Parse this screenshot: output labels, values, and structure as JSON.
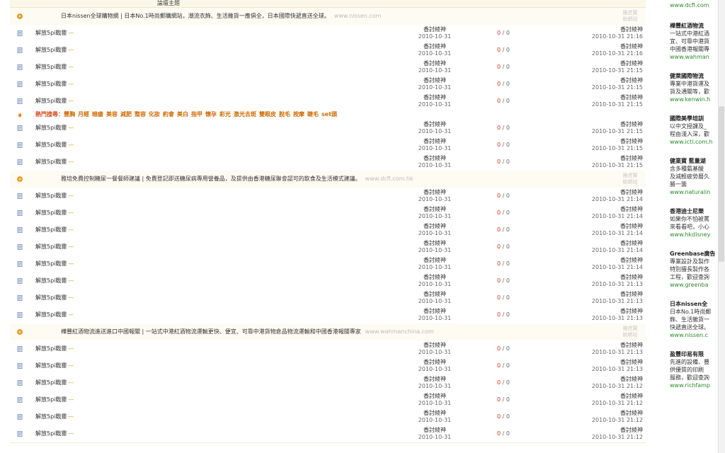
{
  "header": {
    "title": "論壇主題"
  },
  "colors": {
    "accent_red": "#e0301e",
    "hot_orange": "#d06a00",
    "sidebar_url_green": "#2b8a2b"
  },
  "topic_title": "解放5pi戰靈",
  "author_name": "香討綾神",
  "date": "2010-10-31",
  "ad_link_label": "雅虎贊\n助網站",
  "rows": [
    {
      "type": "ad",
      "text": "日本nissen全球購物網 | 日本No.1時尚郵購網站，潮流衣飾、生活雜貨一應俱全，日本國際快遞直送全球。",
      "url": "www.nissen.com"
    },
    {
      "type": "topic",
      "replies": "0",
      "views": "0",
      "last_name": "香討綾神",
      "last_time": "2010-10-31 21:16"
    },
    {
      "type": "topic",
      "replies": "0",
      "views": "0",
      "last_name": "香討綾神",
      "last_time": "2010-10-31 21:16"
    },
    {
      "type": "topic",
      "replies": "0",
      "views": "0",
      "last_name": "香討綾神",
      "last_time": "2010-10-31 21:15"
    },
    {
      "type": "topic",
      "replies": "0",
      "views": "0",
      "last_name": "香討綾神",
      "last_time": "2010-10-31 21:15"
    },
    {
      "type": "topic",
      "replies": "0",
      "views": "0",
      "last_name": "香討綾神",
      "last_time": "2010-10-31 21:15"
    },
    {
      "type": "hot"
    },
    {
      "type": "topic",
      "replies": "0",
      "views": "0",
      "last_name": "香討綾神",
      "last_time": "2010-10-31 21:15"
    },
    {
      "type": "topic",
      "replies": "0",
      "views": "0",
      "last_name": "香討綾神",
      "last_time": "2010-10-31 21:15"
    },
    {
      "type": "topic",
      "replies": "0",
      "views": "0",
      "last_name": "香討綾神",
      "last_time": "2010-10-31 21:15"
    },
    {
      "type": "ad",
      "text": "雅培免費控制糖尿一餐餐師建議 | 免費登記即送糖尿病專用營養品，及提供由香港糖尿聯會認可的飲食及生活模式建議。",
      "url": "www.dcfl.com.hk"
    },
    {
      "type": "topic",
      "replies": "0",
      "views": "0",
      "last_name": "香討綾神",
      "last_time": "2010-10-31 21:14"
    },
    {
      "type": "topic",
      "replies": "0",
      "views": "0",
      "last_name": "香討綾神",
      "last_time": "2010-10-31 21:14"
    },
    {
      "type": "topic",
      "replies": "0",
      "views": "0",
      "last_name": "香討綾神",
      "last_time": "2010-10-31 21:14"
    },
    {
      "type": "topic",
      "replies": "0",
      "views": "0",
      "last_name": "香討綾神",
      "last_time": "2010-10-31 21:14"
    },
    {
      "type": "topic",
      "replies": "0",
      "views": "0",
      "last_name": "香討綾神",
      "last_time": "2010-10-31 21:14"
    },
    {
      "type": "topic",
      "replies": "0",
      "views": "0",
      "last_name": "香討綾神",
      "last_time": "2010-10-31 21:13"
    },
    {
      "type": "topic",
      "replies": "0",
      "views": "0",
      "last_name": "香討綾神",
      "last_time": "2010-10-31 21:13"
    },
    {
      "type": "topic",
      "replies": "0",
      "views": "0",
      "last_name": "香討綾神",
      "last_time": "2010-10-31 21:13"
    },
    {
      "type": "ad",
      "text": "樺豐紅酒物流進送進口中國報關 | 一站式中港紅酒物流運輸更快、便宜、可靠中港貨物倉品物流運輸和中國香港報關專家",
      "url": "www.wahmanchina.com"
    },
    {
      "type": "topic",
      "replies": "0",
      "views": "0",
      "last_name": "香討綾神",
      "last_time": "2010-10-31 21:13"
    },
    {
      "type": "topic",
      "replies": "0",
      "views": "0",
      "last_name": "香討綾神",
      "last_time": "2010-10-31 21:13"
    },
    {
      "type": "topic",
      "replies": "0",
      "views": "0",
      "last_name": "香討綾神",
      "last_time": "2010-10-31 21:12"
    },
    {
      "type": "topic",
      "replies": "0",
      "views": "0",
      "last_name": "香討綾神",
      "last_time": "2010-10-31 21:12"
    },
    {
      "type": "topic",
      "replies": "0",
      "views": "0",
      "last_name": "香討綾神",
      "last_time": "2010-10-31 21:12"
    },
    {
      "type": "topic",
      "replies": "0",
      "views": "0",
      "last_name": "香討綾神",
      "last_time": "2010-10-31 21:12"
    }
  ],
  "hot_search": {
    "label": "熱門搜尋：",
    "keywords": [
      "豐胸",
      "月經",
      "暗瘡",
      "美容",
      "減肥",
      "整容",
      "化妝",
      "約會",
      "美白",
      "指甲",
      "懷孕",
      "彩光",
      "激光去斑",
      "雙眼皮",
      "脫毛",
      "按摩",
      "睫毛",
      "set頭"
    ]
  },
  "sidebar": [
    {
      "title": "",
      "desc": [],
      "url": "www.dcfl.com"
    },
    {
      "title": "樺豐紅酒物流",
      "desc": [
        "一站式中港紅酒",
        "宜、可靠中港貨",
        "中國香港報關專"
      ],
      "url": "www.wahman"
    },
    {
      "title": "健萊國際物流",
      "desc": [
        "專業中港貨運及",
        "貨及通關等，歡"
      ],
      "url": "www.kenwin.h"
    },
    {
      "title": "國際美學培訓",
      "desc": [
        "以中文授課及_",
        "程由淺入深，歡"
      ],
      "url": "www.ictl.com.h"
    },
    {
      "title": "健業寶 藍量湖",
      "desc": [
        "含多種氨基酸",
        "及減輕疲勞曆久",
        "勝一籌"
      ],
      "url": "www.naturalin"
    },
    {
      "title": "香港迪士尼樂",
      "desc": [
        "如果你不怕被罵",
        "來看看吧，小心"
      ],
      "url": "www.hkdisney"
    },
    {
      "title": "Greenbase廣告",
      "desc": [
        "專業設計及製作",
        "特別擅長製作各",
        "工程，歡迎查詢"
      ],
      "url": "www.greenba"
    },
    {
      "title": "日本nissen全",
      "desc": [
        "日本No.1時尚郵",
        "飾、生活雜貨一",
        "快遞直送全球。"
      ],
      "url": "www.nissen.c"
    },
    {
      "title": "盈豐印易有限",
      "desc": [
        "先進的設備、豐",
        "供優質的印刷",
        "服務，歡迎查詢"
      ],
      "url": "www.richfamp"
    }
  ]
}
